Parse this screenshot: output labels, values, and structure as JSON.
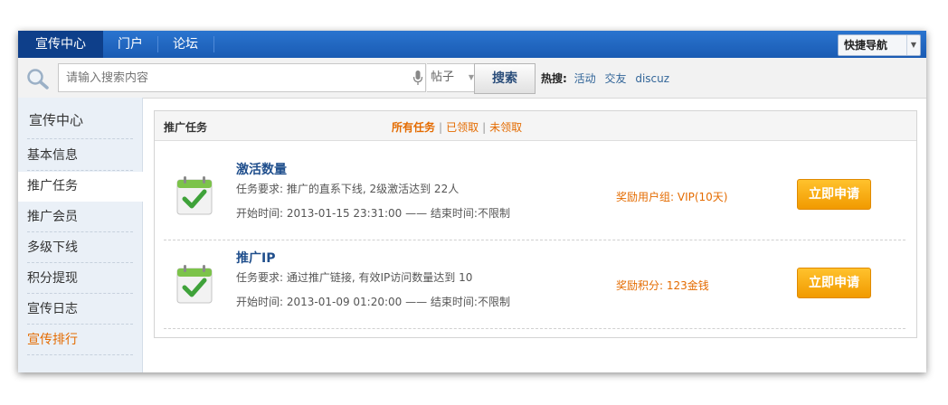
{
  "nav": {
    "tabs": [
      {
        "label": "宣传中心",
        "active": true
      },
      {
        "label": "门户",
        "active": false
      },
      {
        "label": "论坛",
        "active": false
      }
    ],
    "quick_nav_label": "快捷导航"
  },
  "search": {
    "placeholder": "请输入搜索内容",
    "type_label": "帖子",
    "button_label": "搜索",
    "hot_label": "热搜:",
    "hot_terms": [
      "活动",
      "交友",
      "discuz"
    ]
  },
  "sidebar": {
    "title": "宣传中心",
    "items": [
      {
        "label": "基本信息"
      },
      {
        "label": "推广任务",
        "active": true
      },
      {
        "label": "推广会员"
      },
      {
        "label": "多级下线"
      },
      {
        "label": "积分提现"
      },
      {
        "label": "宣传日志"
      },
      {
        "label": "宣传排行",
        "highlight": true
      }
    ]
  },
  "main": {
    "title": "推广任务",
    "filters": [
      "所有任务",
      "已领取",
      "未领取"
    ],
    "tasks": [
      {
        "name": "激活数量",
        "requirement": "任务要求: 推广的直系下线, 2级激活达到 22人",
        "time": "开始时间: 2013-01-15 23:31:00  ——  结束时间:不限制",
        "reward": "奖励用户组: VIP(10天)",
        "button": "立即申请"
      },
      {
        "name": "推广IP",
        "requirement": "任务要求: 通过推广链接, 有效IP访问数量达到 10",
        "time": "开始时间: 2013-01-09 01:20:00  ——  结束时间:不限制",
        "reward": "奖励积分: 123金钱",
        "button": "立即申请"
      }
    ]
  },
  "colors": {
    "nav_blue": "#1a5bb3",
    "nav_active": "#0e3f8a",
    "accent_orange": "#e46b00",
    "button_orange": "#f5a300",
    "link_blue": "#1f4e8c"
  }
}
